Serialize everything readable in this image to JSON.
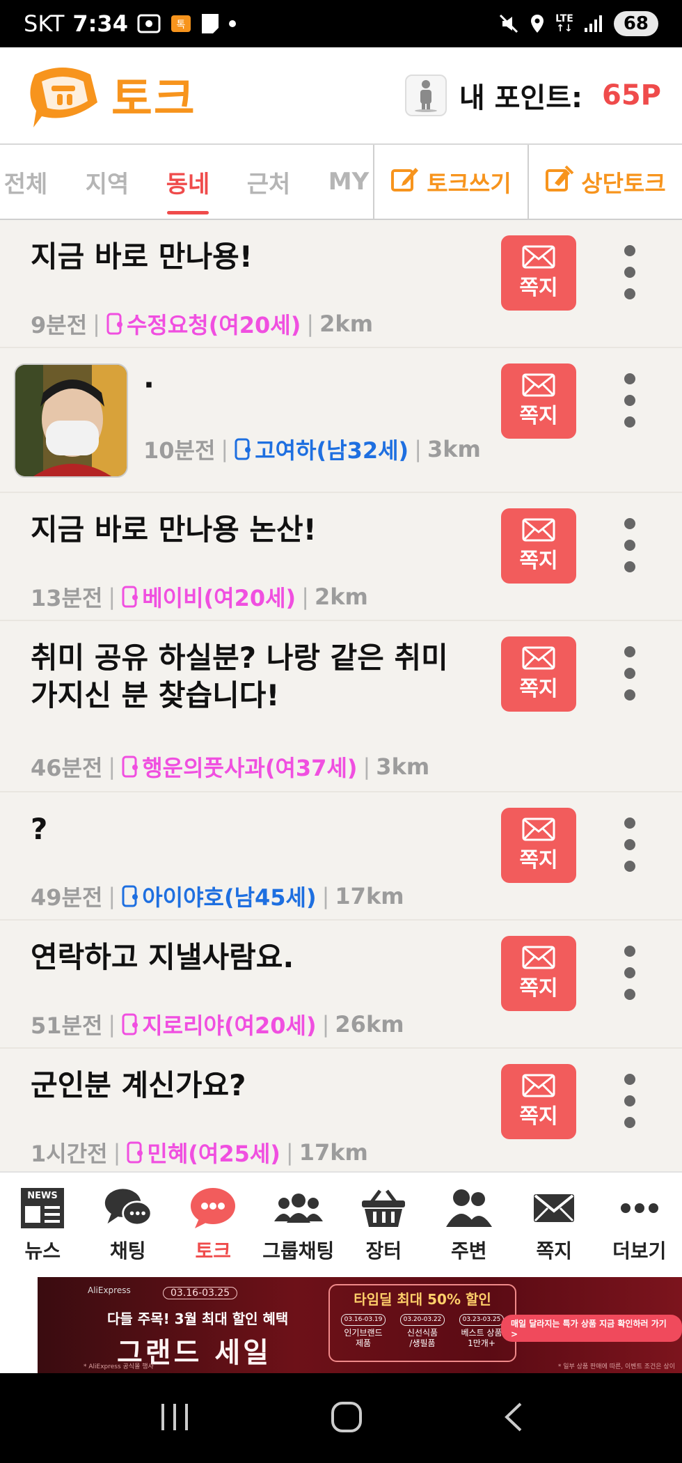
{
  "status_bar": {
    "carrier": "SKT",
    "time": "7:34",
    "battery": "68",
    "network": "LTE"
  },
  "header": {
    "logo_title": "토크",
    "points_label": "내 포인트:",
    "points_value": "65P"
  },
  "tabs": [
    {
      "label": "전체",
      "active": false
    },
    {
      "label": "지역",
      "active": false
    },
    {
      "label": "동네",
      "active": true
    },
    {
      "label": "근처",
      "active": false
    },
    {
      "label": "MY",
      "active": false
    }
  ],
  "actions": {
    "write": "토크쓰기",
    "top": "상단토크"
  },
  "list": {
    "message_label": "쪽지",
    "items": [
      {
        "title": "지금 바로 만나용!",
        "time": "9분전",
        "nick": "수정요청(여20세)",
        "gender": "f",
        "distance": "2km"
      },
      {
        "title": "·",
        "time": "10분전",
        "nick": "고여하(남32세)",
        "gender": "m",
        "distance": "3km",
        "has_photo": true
      },
      {
        "title": "지금 바로 만나용 논산!",
        "time": "13분전",
        "nick": "베이비(여20세)",
        "gender": "f",
        "distance": "2km"
      },
      {
        "title_line1": "취미 공유 하실분? 나랑 같은 취미",
        "title_line2": "가지신 분 찾습니다!",
        "time": "46분전",
        "nick": "행운의풋사과(여37세)",
        "gender": "f",
        "distance": "3km"
      },
      {
        "title": "?",
        "time": "49분전",
        "nick": "아이야호(남45세)",
        "gender": "m",
        "distance": "17km"
      },
      {
        "title": "연락하고 지낼사람요.",
        "time": "51분전",
        "nick": "지로리야(여20세)",
        "gender": "f",
        "distance": "26km"
      },
      {
        "title": "군인분 계신가요?",
        "time": "1시간전",
        "nick": "민혜(여25세)",
        "gender": "f",
        "distance": "17km"
      }
    ]
  },
  "bottom_nav": [
    {
      "label": "뉴스",
      "icon": "news-icon"
    },
    {
      "label": "채팅",
      "icon": "chat-icon"
    },
    {
      "label": "토크",
      "icon": "talk-icon",
      "active": true
    },
    {
      "label": "그룹채팅",
      "icon": "group-chat-icon"
    },
    {
      "label": "장터",
      "icon": "market-basket-icon"
    },
    {
      "label": "주변",
      "icon": "nearby-people-icon"
    },
    {
      "label": "쪽지",
      "icon": "envelope-icon"
    },
    {
      "label": "더보기",
      "icon": "more-icon"
    }
  ],
  "ad": {
    "brand": "AliExpress",
    "date": "03.16-03.25",
    "subtitle": "다들 주목! 3월 최대 할인 혜택",
    "title": "그랜드 세일",
    "box_title": "타임딜 최대 50% 할인",
    "chips": [
      {
        "date": "03.16-03.19",
        "text1": "인기브랜드",
        "text2": "제품"
      },
      {
        "date": "03.20-03.22",
        "text1": "신선식품",
        "text2": "/생필품"
      },
      {
        "date": "03.23-03.25",
        "text1": "베스트 상품",
        "text2": "1만개+"
      }
    ],
    "cta": "매일 달라지는 특가 상품 지금 확인하러 가기 >",
    "note": "* 일부 상품 판매에 따른, 이벤트 조건은 상이",
    "note_left": "* AliExpress 공식몰 행사"
  },
  "colors": {
    "accent_red": "#ef4b4b",
    "brand_orange": "#f7941d",
    "female_nick": "#f04fe0",
    "male_nick": "#1e6fe0",
    "message_button": "#f25c5c"
  }
}
